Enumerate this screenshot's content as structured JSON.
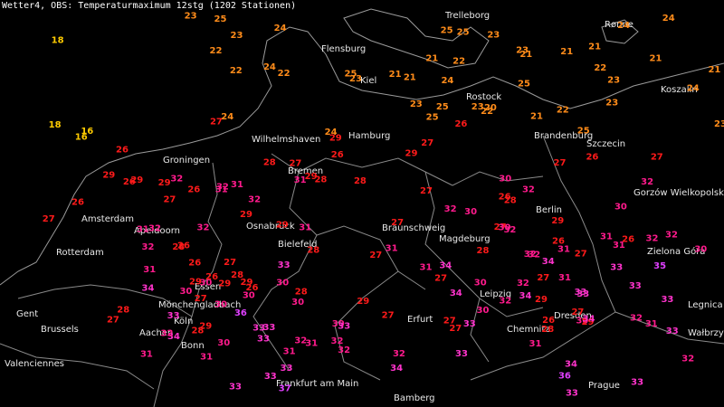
{
  "title": "Wetter4, OBS: Temperaturmaximum 12stg (1202 Stationen)",
  "colors": {
    "background": "#000000",
    "le18": "#ffcc00",
    "t19_25": "#ff8c1a",
    "t26_29": "#ff1a1a",
    "t30_32": "#ff1a8c",
    "t33_34": "#ff33cc",
    "ge35": "#e040ff",
    "city_label": "#e8e8e8",
    "borders": "#8a8a8a"
  },
  "cities": [
    {
      "name": "Flensburg"
    },
    {
      "name": "Kiel"
    },
    {
      "name": "Rostock"
    },
    {
      "name": "Hamburg"
    },
    {
      "name": "Bremen"
    },
    {
      "name": "Groningen"
    },
    {
      "name": "Wilhelmshaven"
    },
    {
      "name": "Amsterdam"
    },
    {
      "name": "Apeldoorn"
    },
    {
      "name": "Rotterdam"
    },
    {
      "name": "Osnabrück"
    },
    {
      "name": "Bielefeld"
    },
    {
      "name": "Braunschweig"
    },
    {
      "name": "Magdeburg"
    },
    {
      "name": "Berlin"
    },
    {
      "name": "Brandenburg"
    },
    {
      "name": "Szczecin"
    },
    {
      "name": "Koszalin"
    },
    {
      "name": "Gorzów Wielkopolski"
    },
    {
      "name": "Zielona Góra"
    },
    {
      "name": "Legnica"
    },
    {
      "name": "Wałbrzych"
    },
    {
      "name": "Dresden"
    },
    {
      "name": "Chemnitz"
    },
    {
      "name": "Leipzig"
    },
    {
      "name": "Erfurt"
    },
    {
      "name": "Mönchengladbach"
    },
    {
      "name": "Essen"
    },
    {
      "name": "Aachen"
    },
    {
      "name": "Köln"
    },
    {
      "name": "Bonn"
    },
    {
      "name": "Gent"
    },
    {
      "name": "Brussels"
    },
    {
      "name": "Valenciennes"
    },
    {
      "name": "Frankfurt am Main"
    },
    {
      "name": "Bamberg"
    },
    {
      "name": "Prague"
    },
    {
      "name": "Rønne"
    },
    {
      "name": "Trelleborg"
    }
  ],
  "stations": [
    16,
    16,
    18,
    18,
    22,
    21,
    25,
    23,
    24,
    21,
    24,
    25,
    26,
    23,
    23,
    27,
    26,
    26,
    26,
    27,
    27,
    27,
    27,
    25,
    28,
    21,
    25,
    24,
    23,
    22,
    20,
    21,
    23,
    25,
    22,
    23,
    21,
    24,
    22,
    21,
    23,
    22,
    21,
    21,
    25,
    24,
    26,
    25,
    26,
    24,
    24,
    26,
    27,
    26,
    26,
    26,
    24,
    23,
    22,
    23,
    22,
    21,
    23,
    25,
    27,
    26,
    28,
    27,
    27,
    27,
    27,
    29,
    28,
    27,
    26,
    27,
    29,
    29,
    28,
    29,
    27,
    28,
    29,
    30,
    29,
    30,
    31,
    30,
    29,
    28,
    27,
    29,
    28,
    29,
    30,
    30,
    30,
    31,
    32,
    31,
    30,
    30,
    31,
    32,
    32,
    31,
    32,
    32,
    33,
    32,
    31,
    30,
    31,
    32,
    33,
    33,
    34,
    33,
    32,
    33,
    32,
    31,
    30,
    33,
    34,
    34,
    33,
    33,
    32,
    31,
    33,
    33,
    34,
    32,
    31,
    32,
    33,
    34,
    35,
    33,
    34,
    32,
    31,
    30,
    32,
    33,
    34,
    36,
    36,
    37,
    33,
    32,
    31,
    30,
    32,
    33,
    31,
    32,
    30,
    29,
    31,
    32,
    33,
    33,
    32,
    31,
    30,
    32,
    34,
    33,
    32,
    33,
    34,
    32,
    31,
    29,
    30,
    31,
    32,
    28,
    29,
    27,
    26,
    28,
    27,
    29,
    28,
    27,
    26,
    27,
    28,
    29,
    30,
    31,
    29,
    28,
    27,
    26,
    27,
    29
  ]
}
